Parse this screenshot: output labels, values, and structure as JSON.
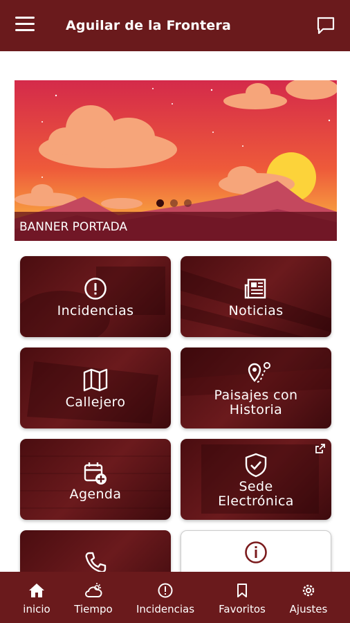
{
  "header": {
    "title": "Aguilar de la Frontera"
  },
  "banner": {
    "label": "BANNER PORTADA",
    "slides": 3,
    "active_slide": 1
  },
  "tiles": [
    {
      "label": "Incidencias"
    },
    {
      "label": "Noticias"
    },
    {
      "label": "Callejero"
    },
    {
      "label_line1": "Paisajes con",
      "label_line2": "Historia"
    },
    {
      "label": "Agenda"
    },
    {
      "label_line1": "Sede",
      "label_line2": "Electrónica"
    },
    {
      "icon": "phone-icon"
    },
    {
      "icon": "info-icon"
    }
  ],
  "bottom_nav": [
    {
      "label": "inicio",
      "icon": "home-icon"
    },
    {
      "label": "Tiempo",
      "icon": "weather-icon"
    },
    {
      "label": "Incidencias",
      "icon": "alert-icon"
    },
    {
      "label": "Favoritos",
      "icon": "bookmark-icon"
    },
    {
      "label": "Ajustes",
      "icon": "settings-icon"
    }
  ],
  "colors": {
    "primary": "#6a1a1c",
    "tile_dark": "#5a1215",
    "icon_red": "#7a1a1c"
  }
}
